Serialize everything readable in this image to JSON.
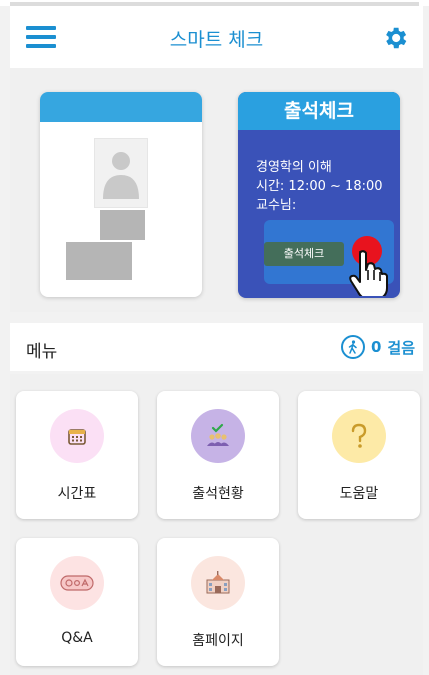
{
  "header": {
    "title": "스마트 체크",
    "menu_icon": "hamburger-menu-icon",
    "settings_icon": "gear-icon"
  },
  "attendance_card": {
    "title": "출석체크",
    "course": "경영학의 이해",
    "time": "시간: 12:00 ~ 18:00",
    "professor": "교수님:",
    "button_label": "출석체크"
  },
  "menu": {
    "title": "메뉴",
    "steps_count": "0",
    "steps_unit": "걸음"
  },
  "tiles": [
    {
      "label": "시간표",
      "icon": "calendar-icon"
    },
    {
      "label": "출석현황",
      "icon": "attendance-group-icon"
    },
    {
      "label": "도움말",
      "icon": "help-question-icon"
    },
    {
      "label": "Q&A",
      "icon": "qa-icon"
    },
    {
      "label": "홈페이지",
      "icon": "school-building-icon"
    }
  ],
  "colors": {
    "primary": "#1b8fd1",
    "card_blue": "#3a52b8",
    "card_header": "#2aa0e0",
    "button_green": "#446e5a",
    "red_dot": "#e8131e"
  }
}
